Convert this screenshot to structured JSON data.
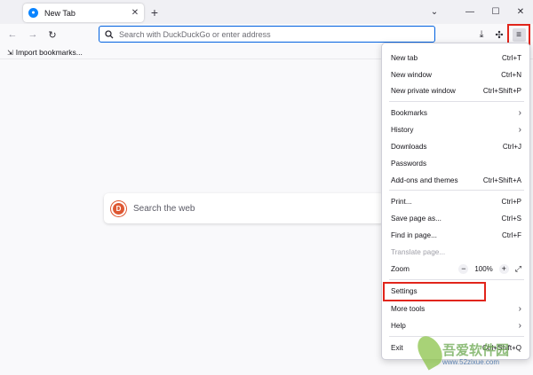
{
  "tab": {
    "title": "New Tab"
  },
  "urlbar": {
    "placeholder": "Search with DuckDuckGo or enter address"
  },
  "bookmarks_toolbar": {
    "import_label": "Import bookmarks..."
  },
  "content": {
    "search_placeholder": "Search the web"
  },
  "menu": {
    "new_tab": {
      "label": "New tab",
      "shortcut": "Ctrl+T"
    },
    "new_window": {
      "label": "New window",
      "shortcut": "Ctrl+N"
    },
    "new_private_window": {
      "label": "New private window",
      "shortcut": "Ctrl+Shift+P"
    },
    "bookmarks": {
      "label": "Bookmarks"
    },
    "history": {
      "label": "History"
    },
    "downloads": {
      "label": "Downloads",
      "shortcut": "Ctrl+J"
    },
    "passwords": {
      "label": "Passwords"
    },
    "addons": {
      "label": "Add-ons and themes",
      "shortcut": "Ctrl+Shift+A"
    },
    "print": {
      "label": "Print...",
      "shortcut": "Ctrl+P"
    },
    "save_page": {
      "label": "Save page as...",
      "shortcut": "Ctrl+S"
    },
    "find": {
      "label": "Find in page...",
      "shortcut": "Ctrl+F"
    },
    "translate": {
      "label": "Translate page..."
    },
    "zoom": {
      "label": "Zoom",
      "value": "100%"
    },
    "settings": {
      "label": "Settings"
    },
    "more_tools": {
      "label": "More tools"
    },
    "help": {
      "label": "Help"
    },
    "exit": {
      "label": "Exit",
      "shortcut": "Ctrl+Shift+Q"
    }
  },
  "watermark": {
    "title": "吾爱软件园",
    "url": "www.52zixue.com"
  },
  "colors": {
    "accent": "#0061e0",
    "highlight": "#e1251b"
  }
}
